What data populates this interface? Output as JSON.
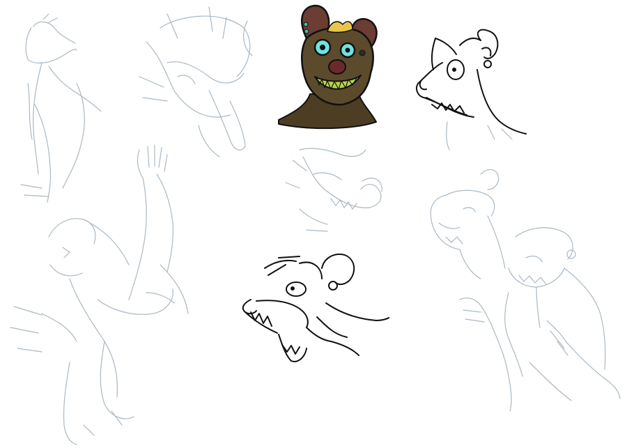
{
  "image": {
    "background": "#ffffff",
    "sketch_color": "#a9b8c4",
    "ink_color": "#111111",
    "fur_color": "#5b4a2c",
    "ear_color": "#6b3d33",
    "eye_color": "#6fe3e0",
    "hair_color": "#e7c64a",
    "tongue_color": "#b9d44a",
    "figures": [
      {
        "name": "sketch-standing-figure",
        "style": "pencil sketch"
      },
      {
        "name": "sketch-tongue-face",
        "style": "pencil sketch"
      },
      {
        "name": "colored-hyena-head",
        "style": "colored"
      },
      {
        "name": "inked-bear-head",
        "style": "line art"
      },
      {
        "name": "sketch-grin-head",
        "style": "pencil sketch"
      },
      {
        "name": "sketch-side-head",
        "style": "pencil sketch"
      },
      {
        "name": "sketch-dancing-figure",
        "style": "pencil sketch"
      },
      {
        "name": "inked-rat-head",
        "style": "line art"
      },
      {
        "name": "sketch-gesturing-figure",
        "style": "pencil sketch"
      }
    ]
  }
}
